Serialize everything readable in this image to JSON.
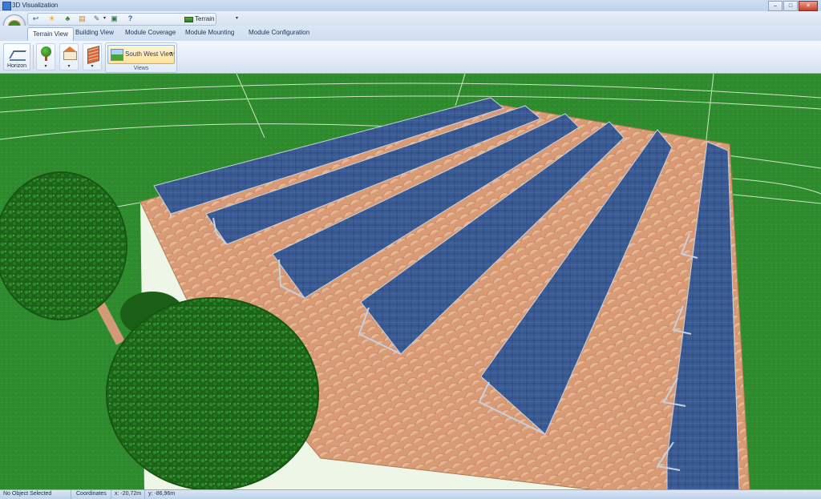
{
  "window": {
    "title": "3D Visualization",
    "buttons": {
      "minimize": "–",
      "maximize": "□",
      "close": "✕"
    }
  },
  "qat": {
    "icons": [
      "undo-icon",
      "sun-icon",
      "tree-icon",
      "save-icon",
      "pen-icon",
      "export-icon",
      "help-icon"
    ],
    "help_label": "?",
    "terrain_select": "Terrain"
  },
  "tabs": [
    {
      "label": "Terrain View",
      "active": true
    },
    {
      "label": "Building View",
      "active": false
    },
    {
      "label": "Module Coverage",
      "active": false
    },
    {
      "label": "Module Mounting",
      "active": false
    },
    {
      "label": "Module Configuration",
      "active": false
    }
  ],
  "ribbon": {
    "horizon_label": "Horizon",
    "views_button": "South West View",
    "views_group_label": "Views",
    "dropdown_arrow": "▾"
  },
  "status": {
    "selection": "No Object Selected",
    "coordinates_label": "Coordinates",
    "x": "x: -20,72m",
    "y": "y: -86,96m"
  },
  "colors": {
    "grass": "#2e8a2b",
    "roof_tile": "#d9a07c",
    "wall": "#e8f3de",
    "panel": "#34507e",
    "tree": "#1d6a1b"
  }
}
